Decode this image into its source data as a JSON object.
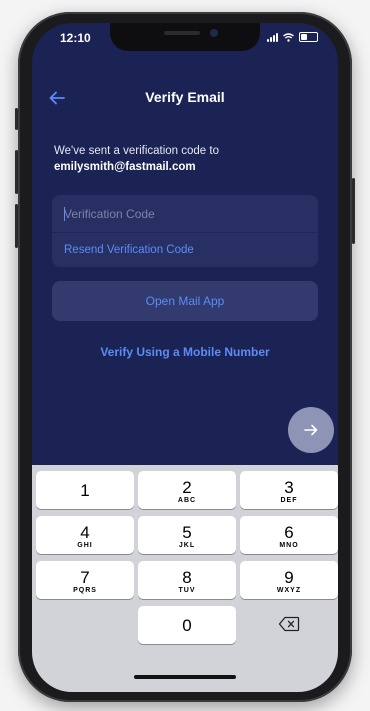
{
  "status_bar": {
    "time": "12:10"
  },
  "header": {
    "title": "Verify Email",
    "back_icon": "arrow-left-icon"
  },
  "message": {
    "line1": "We've sent a verification code to",
    "email": "emilysmith@fastmail.com"
  },
  "code_field": {
    "placeholder": "Verification Code",
    "value": "",
    "resend_label": "Resend Verification Code"
  },
  "open_mail_label": "Open Mail App",
  "mobile_link_label": "Verify Using a Mobile Number",
  "next_icon": "arrow-right-icon",
  "keypad": {
    "keys": [
      {
        "digit": "1",
        "letters": ""
      },
      {
        "digit": "2",
        "letters": "ABC"
      },
      {
        "digit": "3",
        "letters": "DEF"
      },
      {
        "digit": "4",
        "letters": "GHI"
      },
      {
        "digit": "5",
        "letters": "JKL"
      },
      {
        "digit": "6",
        "letters": "MNO"
      },
      {
        "digit": "7",
        "letters": "PQRS"
      },
      {
        "digit": "8",
        "letters": "TUV"
      },
      {
        "digit": "9",
        "letters": "WXYZ"
      },
      {
        "digit": "0",
        "letters": ""
      }
    ],
    "backspace_icon": "backspace-icon"
  },
  "colors": {
    "background": "#1b2354",
    "card": "#283063",
    "accent": "#5b8cf6",
    "keypad": "#d2d3d9"
  }
}
